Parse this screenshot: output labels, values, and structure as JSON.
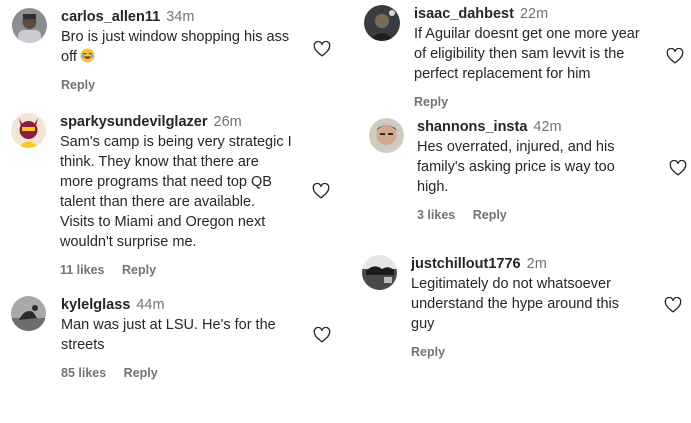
{
  "comments": [
    {
      "username": "carlos_allen11",
      "time": "34m",
      "lines": [
        "Bro is just window shopping his ass",
        "off"
      ],
      "emoji_name": "laughing-crying-emoji",
      "likes": "",
      "reply_label": "Reply"
    },
    {
      "username": "sparkysundevilglazer",
      "time": "26m",
      "lines": [
        "Sam's camp is being very strategic I",
        "think. They know that there are",
        "more programs that need top QB",
        "talent than there are available.",
        "Visits to Miami and Oregon next",
        "wouldn't surprise me."
      ],
      "likes": "11 likes",
      "reply_label": "Reply"
    },
    {
      "username": "kylelglass",
      "time": "44m",
      "lines": [
        "Man was just at LSU. He's for the",
        "streets"
      ],
      "likes": "85 likes",
      "reply_label": "Reply"
    },
    {
      "username": "isaac_dahbest",
      "time": "22m",
      "lines": [
        "If Aguilar doesnt get one more year",
        "of eligibility then sam levvit is the",
        "perfect replacement for him"
      ],
      "likes": "",
      "reply_label": "Reply"
    },
    {
      "username": "shannons_insta",
      "time": "42m",
      "lines": [
        "Hes overrated, injured, and his",
        "family's asking price is way too",
        "high."
      ],
      "likes": "3 likes",
      "reply_label": "Reply"
    },
    {
      "username": "justchillout1776",
      "time": "2m",
      "lines": [
        "Legitimately do not whatsoever",
        "understand the hype around this",
        "guy"
      ],
      "likes": "",
      "reply_label": "Reply"
    }
  ],
  "icons": {
    "like": "heart-outline-icon"
  }
}
